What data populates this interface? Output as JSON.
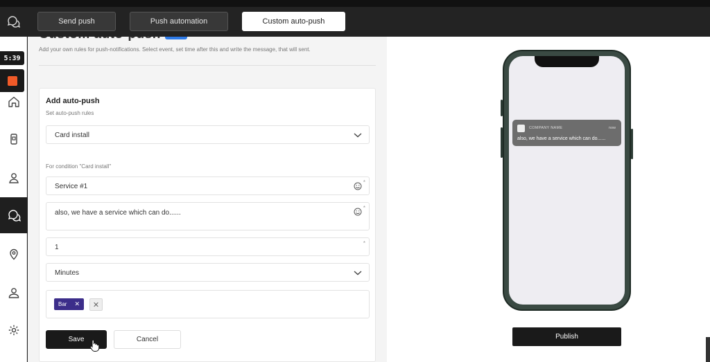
{
  "topbar": {
    "tabs": [
      {
        "label": "Send push"
      },
      {
        "label": "Push automation"
      },
      {
        "label": "Custom auto-push"
      }
    ]
  },
  "recorder": {
    "timer": "5:39"
  },
  "sidebar": {
    "items": [
      {
        "icon": "home-icon"
      },
      {
        "icon": "card-icon"
      },
      {
        "icon": "users-icon"
      },
      {
        "icon": "chat-icon"
      },
      {
        "icon": "location-icon"
      },
      {
        "icon": "user-icon"
      },
      {
        "icon": "gear-icon"
      }
    ]
  },
  "page": {
    "title": "Custom auto-push",
    "subtitle": "Add your own rules for push-notifications. Select event, set time after this and write the message, that will sent."
  },
  "form": {
    "title": "Add auto-push",
    "rules_label": "Set auto-push rules",
    "event_value": "Card install",
    "condition_label": "For condition \"Card install\"",
    "title_value": "Service #1",
    "message_value": "also, we have a service which can do......",
    "time_value": "1",
    "unit_value": "Minutes",
    "tag_label": "Bar",
    "save_label": "Save",
    "cancel_label": "Cancel"
  },
  "preview": {
    "company": "COMPANY NAME",
    "time": "now",
    "message": "also, we have a service which can do......",
    "publish_label": "Publish"
  },
  "colors": {
    "accent": "#3c2d8a",
    "record": "#f05a28",
    "dark": "#1a1a1a"
  }
}
